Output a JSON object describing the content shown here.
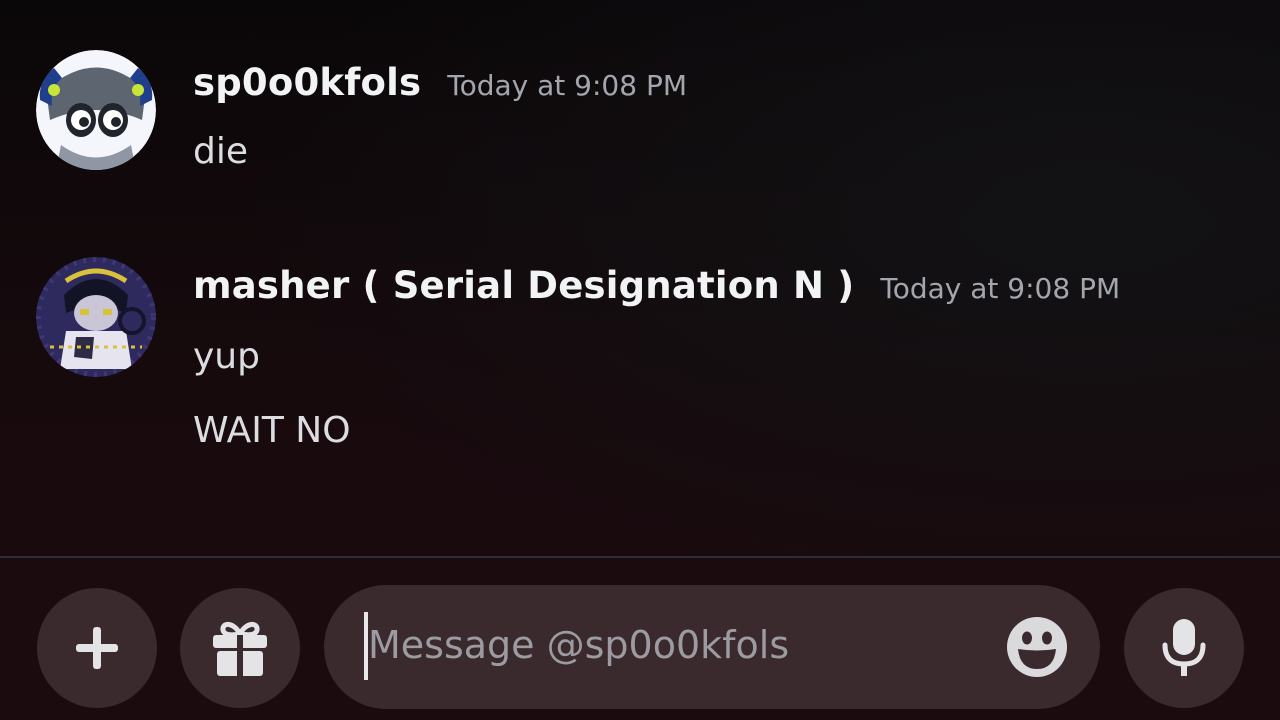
{
  "messages": [
    {
      "username": "sp0o0kfols",
      "timestamp": "Today at 9:08 PM",
      "lines": [
        "die"
      ]
    },
    {
      "username": "masher ( Serial Designation N )",
      "timestamp": "Today at 9:08 PM",
      "lines": [
        "yup",
        "WAIT NO"
      ]
    }
  ],
  "composer": {
    "placeholder": "Message @sp0o0kfols",
    "icons": {
      "add": "plus-icon",
      "gift": "gift-icon",
      "emoji": "emoji-icon",
      "voice": "microphone-icon"
    }
  },
  "colors": {
    "background": "#0b0709",
    "composer_background": "#1b0b0e",
    "button_fill": "#3a2a2d",
    "username": "#f2f3f5",
    "timestamp": "#a3a6ad",
    "message_text": "#dcdde1",
    "placeholder": "#9b9ba1"
  }
}
